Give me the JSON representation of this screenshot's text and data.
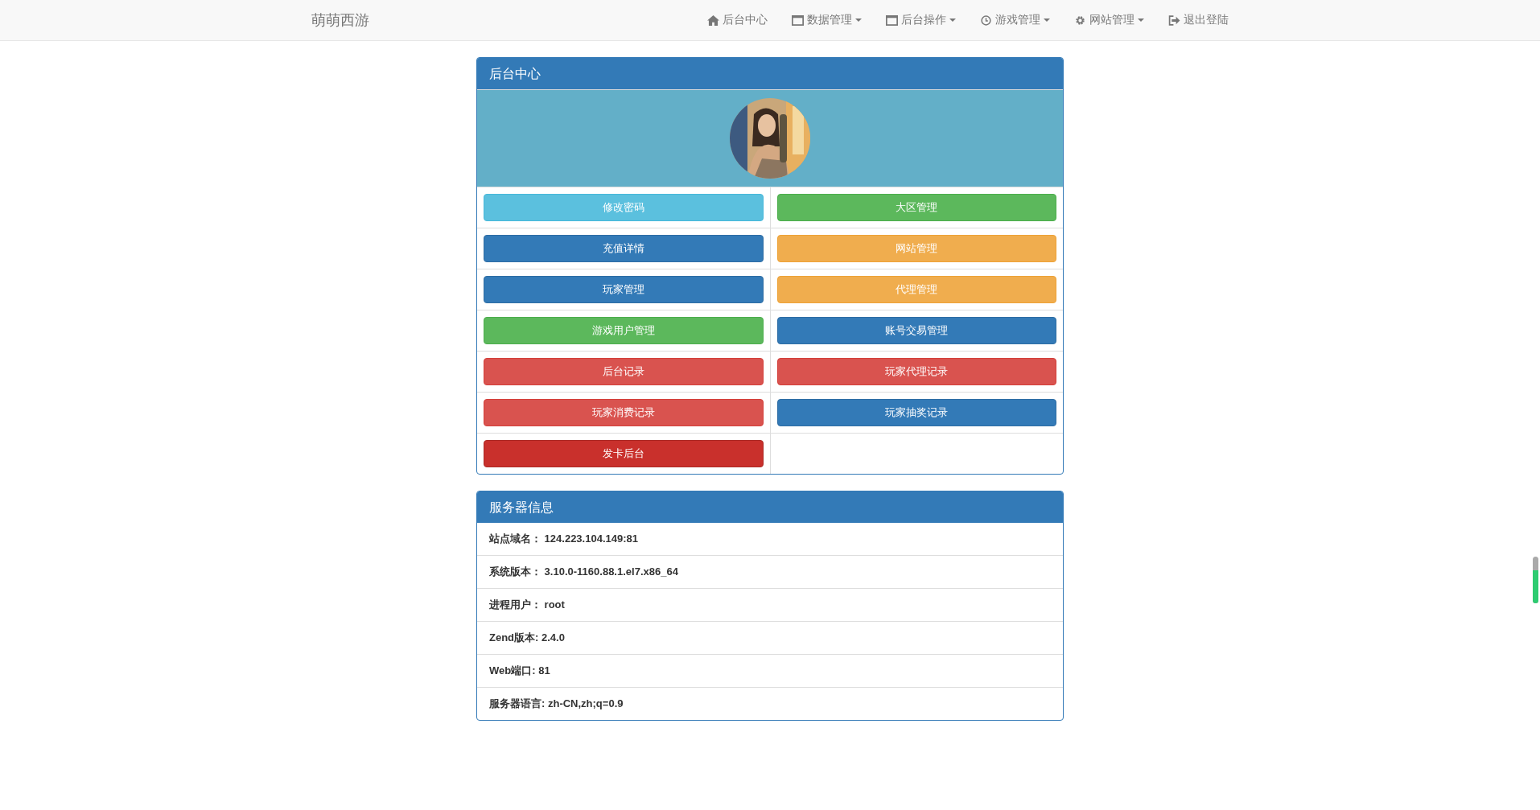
{
  "navbar": {
    "brand": "萌萌西游",
    "items": [
      {
        "label": "后台中心",
        "kind": "home",
        "dropdown": false
      },
      {
        "label": "数据管理",
        "kind": "window",
        "dropdown": true
      },
      {
        "label": "后台操作",
        "kind": "window",
        "dropdown": true
      },
      {
        "label": "游戏管理",
        "kind": "clock",
        "dropdown": true
      },
      {
        "label": "网站管理",
        "kind": "gear",
        "dropdown": true
      },
      {
        "label": "退出登陆",
        "kind": "logout",
        "dropdown": false
      }
    ]
  },
  "admin_panel": {
    "title": "后台中心",
    "buttons": [
      {
        "label": "修改密码",
        "kind": "info"
      },
      {
        "label": "大区管理",
        "kind": "success"
      },
      {
        "label": "充值详情",
        "kind": "primary"
      },
      {
        "label": "网站管理",
        "kind": "warning"
      },
      {
        "label": "玩家管理",
        "kind": "primary"
      },
      {
        "label": "代理管理",
        "kind": "warning"
      },
      {
        "label": "游戏用户管理",
        "kind": "success"
      },
      {
        "label": "账号交易管理",
        "kind": "primary"
      },
      {
        "label": "后台记录",
        "kind": "danger"
      },
      {
        "label": "玩家代理记录",
        "kind": "danger"
      },
      {
        "label": "玩家消费记录",
        "kind": "danger"
      },
      {
        "label": "玩家抽奖记录",
        "kind": "primary"
      },
      {
        "label": "发卡后台",
        "kind": "dark-danger"
      }
    ]
  },
  "server_panel": {
    "title": "服务器信息",
    "rows": [
      "站点域名：  124.223.104.149:81",
      "系统版本：  3.10.0-1160.88.1.el7.x86_64",
      "进程用户：  root",
      "Zend版本: 2.4.0",
      "Web端口: 81",
      "服务器语言: zh-CN,zh;q=0.9"
    ]
  },
  "side_meter": {
    "level": 0.7
  }
}
